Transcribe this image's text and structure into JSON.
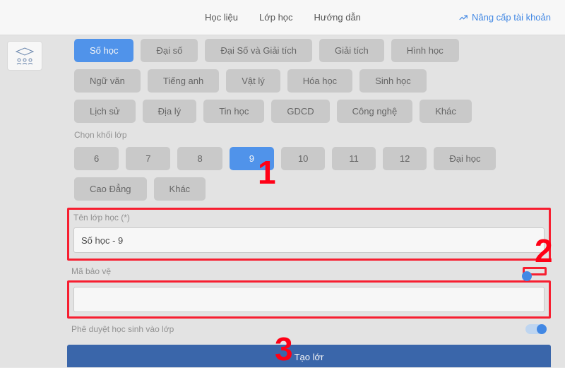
{
  "nav": {
    "items": [
      "Học liệu",
      "Lớp học",
      "Hướng dẫn"
    ],
    "upgrade": "Nâng cấp tài khoản"
  },
  "subjects": {
    "row1": [
      "Số học",
      "Đại số",
      "Đại Số và Giải tích",
      "Giải tích",
      "Hình học"
    ],
    "row2": [
      "Ngữ văn",
      "Tiếng anh",
      "Vật lý",
      "Hóa học",
      "Sinh học"
    ],
    "row3": [
      "Lịch sử",
      "Địa lý",
      "Tin học",
      "GDCD",
      "Công nghệ",
      "Khác"
    ],
    "active": "Số học"
  },
  "grades": {
    "label": "Chọn khối lớp",
    "row1": [
      "6",
      "7",
      "8",
      "9",
      "10",
      "11",
      "12",
      "Đại học"
    ],
    "row2": [
      "Cao Đẳng",
      "Khác"
    ],
    "active": "9"
  },
  "form": {
    "className": {
      "label": "Tên lớp học (*)",
      "value": "Số học - 9"
    },
    "code": {
      "label": "Mã bảo vệ",
      "value": ""
    },
    "approve": {
      "label": "Phê duyệt học sinh vào lớp"
    },
    "submit": "Tạo lớr"
  },
  "annotations": {
    "n1": "1",
    "n2": "2",
    "n3": "3"
  }
}
